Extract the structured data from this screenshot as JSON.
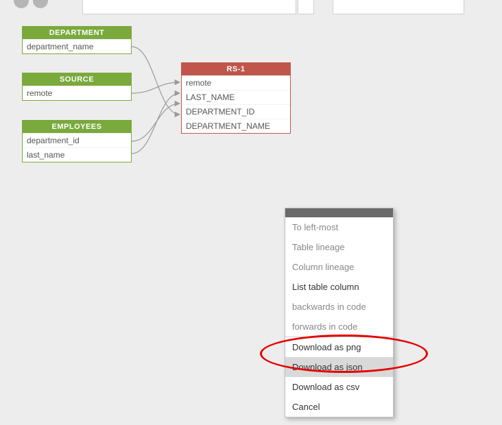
{
  "topbar": {},
  "tables": {
    "department": {
      "title": "DEPARTMENT",
      "cols": [
        "department_name"
      ]
    },
    "source": {
      "title": "SOURCE",
      "cols": [
        "remote"
      ]
    },
    "employees": {
      "title": "EMPLOYEES",
      "cols": [
        "department_id",
        "last_name"
      ]
    },
    "rs1": {
      "title": "RS-1",
      "cols": [
        "remote",
        "LAST_NAME",
        "DEPARTMENT_ID",
        "DEPARTMENT_NAME"
      ]
    }
  },
  "menu": {
    "items": [
      {
        "label": "To left-most",
        "enabled": false
      },
      {
        "label": "Table lineage",
        "enabled": false
      },
      {
        "label": "Column lineage",
        "enabled": false
      },
      {
        "label": "List table column",
        "enabled": true
      },
      {
        "label": "backwards in code",
        "enabled": false
      },
      {
        "label": "forwards in code",
        "enabled": false
      }
    ],
    "items2": [
      {
        "label": "Download as png",
        "enabled": true,
        "highlight": false
      },
      {
        "label": "Download as json",
        "enabled": true,
        "highlight": true
      },
      {
        "label": "Download as csv",
        "enabled": true,
        "highlight": false
      },
      {
        "label": "Cancel",
        "enabled": true,
        "highlight": false
      }
    ]
  }
}
